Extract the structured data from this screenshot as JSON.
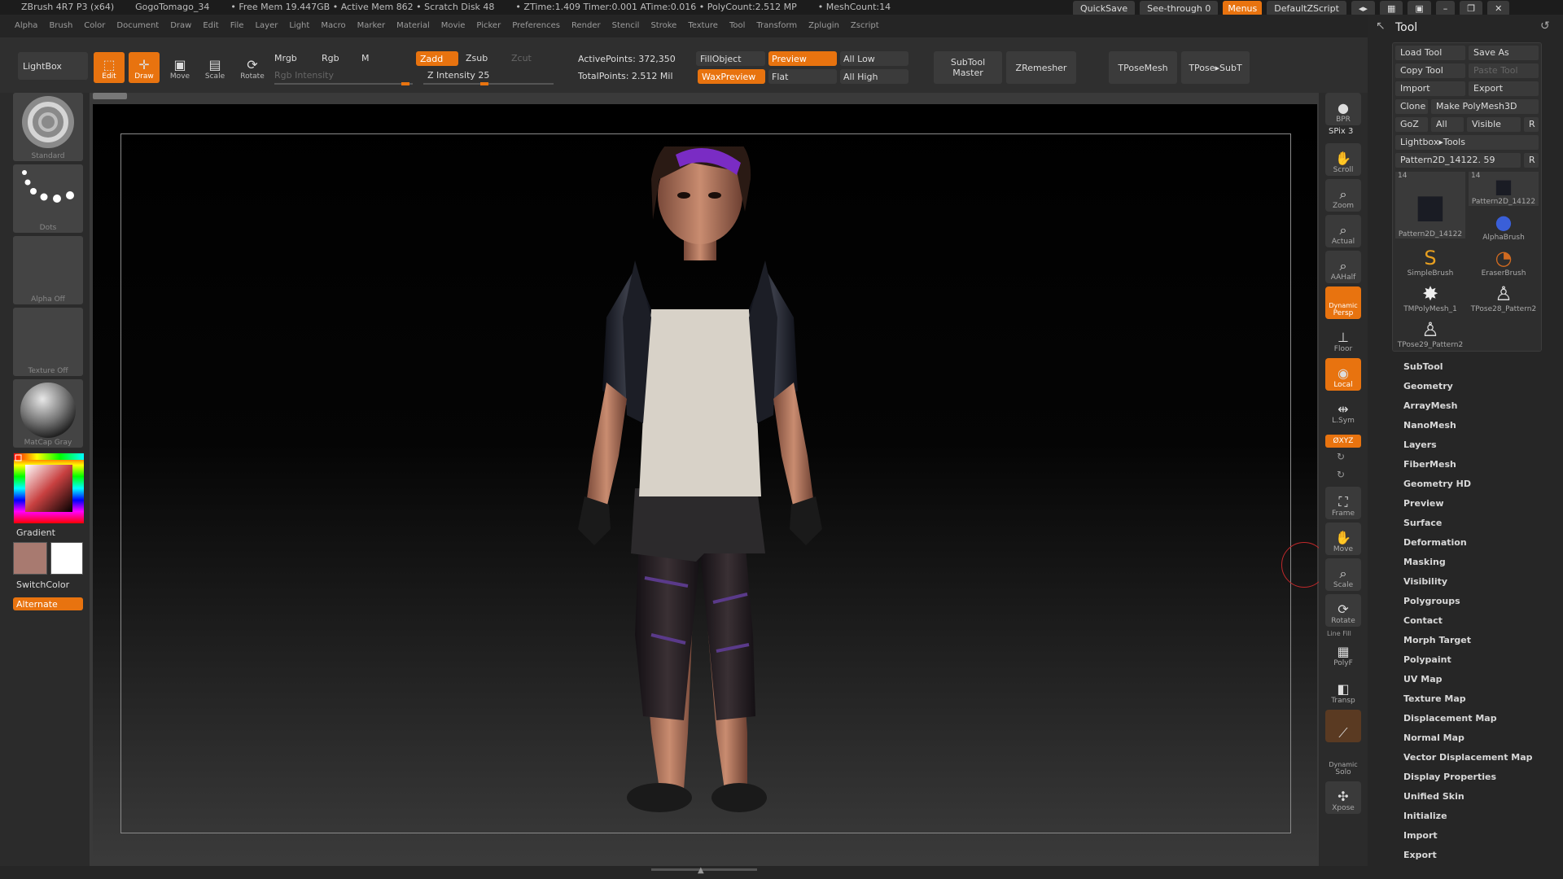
{
  "titlebar": {
    "app": "ZBrush 4R7 P3 (x64)",
    "doc": "GogoTomago_34",
    "free_mem": "• Free Mem 19.447GB • Active Mem 862 • Scratch Disk 48",
    "times": "• ZTime:1.409 Timer:0.001 ATime:0.016 • PolyCount:2.512 MP",
    "mesh": "• MeshCount:14"
  },
  "top_right": {
    "quicksave": "QuickSave",
    "see_through": "See-through  0",
    "menus": "Menus",
    "script": "DefaultZScript"
  },
  "menubar": [
    "Alpha",
    "Brush",
    "Color",
    "Document",
    "Draw",
    "Edit",
    "File",
    "Layer",
    "Light",
    "Macro",
    "Marker",
    "Material",
    "Movie",
    "Picker",
    "Preferences",
    "Render",
    "Stencil",
    "Stroke",
    "Texture",
    "Tool",
    "Transform",
    "Zplugin",
    "Zscript"
  ],
  "toolbar": {
    "lightbox": "LightBox",
    "edit": "Edit",
    "draw": "Draw",
    "move": "Move",
    "scale": "Scale",
    "rotate": "Rotate",
    "mrgb": "Mrgb",
    "rgb": "Rgb",
    "m": "M",
    "rgb_intensity": "Rgb Intensity",
    "zadd": "Zadd",
    "zsub": "Zsub",
    "zcut": "Zcut",
    "z_intensity": "Z Intensity 25",
    "active_points": "ActivePoints: 372,350",
    "total_points": "TotalPoints: 2.512 Mil",
    "fill_object": "FillObject",
    "wax_preview": "WaxPreview",
    "preview": "Preview",
    "flat": "Flat",
    "all_low": "All Low",
    "all_high": "All High",
    "subtool_master_1": "SubTool",
    "subtool_master_2": "Master",
    "zremesher": "ZRemesher",
    "tpose_mesh": "TPoseMesh",
    "tpose_subt": "TPose▸SubT"
  },
  "left": {
    "brush": "Standard",
    "stroke": "Dots",
    "alpha": "Alpha  Off",
    "texture": "Texture  Off",
    "material": "MatCap  Gray",
    "gradient": "Gradient",
    "switch_color": "SwitchColor",
    "alternate": "Alternate"
  },
  "shelf": {
    "bpr": "BPR",
    "spix": "SPix 3",
    "scroll": "Scroll",
    "zoom": "Zoom",
    "actual": "Actual",
    "aahalf": "AAHalf",
    "dynamic": "Dynamic",
    "persp": "Persp",
    "floor": "Floor",
    "local": "Local",
    "lsym": "L.Sym",
    "xyz": "ØXYZ",
    "frame": "Frame",
    "move": "Move",
    "scale": "Scale",
    "rotate": "Rotate",
    "line_fill": "Line Fill",
    "polyf": "PolyF",
    "transp": "Transp",
    "dynamic2": "Dynamic",
    "solo": "Solo",
    "xpose": "Xpose"
  },
  "tool": {
    "title": "Tool",
    "load_tool": "Load Tool",
    "save_as": "Save As",
    "copy_tool": "Copy Tool",
    "paste_tool": "Paste Tool",
    "import": "Import",
    "export": "Export",
    "clone": "Clone",
    "make_polymesh": "Make PolyMesh3D",
    "goz": "GoZ",
    "all": "All",
    "visible": "Visible",
    "r": "R",
    "lightbox_tools": "Lightbox▸Tools",
    "current_tool": "Pattern2D_14122. 59",
    "thumbs": [
      {
        "name": "Pattern2D_14122",
        "count": "14"
      },
      {
        "name": "Pattern2D_14122",
        "count": "14"
      },
      {
        "name": "AlphaBrush",
        "count": ""
      },
      {
        "name": "SimpleBrush",
        "count": ""
      },
      {
        "name": "EraserBrush",
        "count": ""
      },
      {
        "name": "TMPolyMesh_1",
        "count": ""
      },
      {
        "name": "TPose28_Pattern2",
        "count": ""
      },
      {
        "name": "TPose29_Pattern2",
        "count": ""
      }
    ],
    "menu": [
      "SubTool",
      "Geometry",
      "ArrayMesh",
      "NanoMesh",
      "Layers",
      "FiberMesh",
      "Geometry HD",
      "Preview",
      "Surface",
      "Deformation",
      "Masking",
      "Visibility",
      "Polygroups",
      "Contact",
      "Morph Target",
      "Polypaint",
      "UV Map",
      "Texture Map",
      "Displacement Map",
      "Normal Map",
      "Vector Displacement Map",
      "Display Properties",
      "Unified Skin",
      "Initialize",
      "Import",
      "Export"
    ]
  },
  "colors": {
    "accent": "#e8730f",
    "main_color": "#a87a70",
    "secondary_color": "#ffffff"
  }
}
